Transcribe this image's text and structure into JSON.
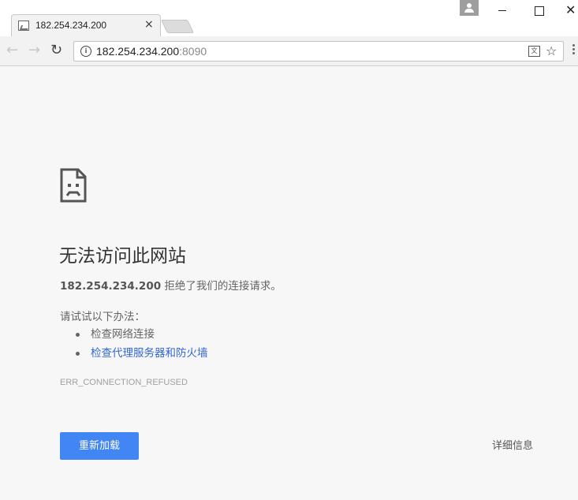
{
  "tab": {
    "title": "182.254.234.200",
    "favicon": "broken-image-icon",
    "close_glyph": "×"
  },
  "window_controls": {
    "close_glyph": "✕"
  },
  "toolbar": {
    "back_glyph": "←",
    "forward_glyph": "→",
    "reload_glyph": "↻",
    "info_glyph": "i",
    "url_host": "182.254.234.200",
    "url_port": ":8090",
    "translate_glyph": "文",
    "star_glyph": "☆"
  },
  "error": {
    "title": "无法访问此网站",
    "host": "182.254.234.200",
    "message": " 拒绝了我们的连接请求。",
    "suggestions_title": "请试试以下办法：",
    "suggestions": [
      "检查网络连接",
      "检查代理服务器和防火墙"
    ],
    "code": "ERR_CONNECTION_REFUSED",
    "reload_label": "重新加载",
    "details_label": "详细信息"
  },
  "colors": {
    "accent": "#4285f4",
    "link": "#3367d6",
    "page_bg": "#f7f7f7"
  }
}
